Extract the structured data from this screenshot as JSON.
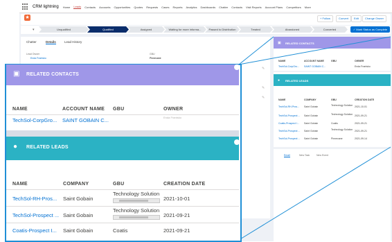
{
  "app": {
    "name": "CRM lightning"
  },
  "nav": {
    "items": [
      "Home",
      "Leads",
      "Contacts",
      "Accounts",
      "Opportunities",
      "Quotes",
      "Requests",
      "Cases",
      "Reports",
      "Analytics",
      "Dashboards",
      "Chatter",
      "Contacts",
      "Visit Reports",
      "Account Plans",
      "Competitors",
      "More"
    ],
    "active_index": 1
  },
  "header": {
    "buttons": [
      "+ Follow",
      "Convert",
      "Edit",
      "Change Owner"
    ]
  },
  "path": {
    "stages": [
      "Unqualified",
      "Qualified",
      "Assigned",
      "Waiting for more informa...",
      "Passed to Distribution",
      "Treated",
      "Abandoned",
      "Converted"
    ],
    "current_index": 1,
    "mark_status_label": "✓ Mark Status as Complete"
  },
  "details": {
    "tabs": [
      "Chatter",
      "Details",
      "Lead History"
    ],
    "active_tab": 1,
    "lead_owner_label": "Lead Owner",
    "lead_owner_value": "Enda Frantsko",
    "gbu_label": "GBU",
    "gbu_value": "Pinnecane"
  },
  "related_contacts": {
    "title": "RELATED CONTACTS",
    "columns": [
      "NAME",
      "ACCOUNT NAME",
      "GBU",
      "OWNER"
    ],
    "rows": [
      {
        "name": "TechSol-CorpGro...",
        "account": "SAINT GOBAIN C...",
        "gbu": "",
        "owner": "Enda Frantsko"
      }
    ]
  },
  "related_leads": {
    "title": "RELATED LEADS",
    "columns": [
      "NAME",
      "COMPANY",
      "GBU",
      "CREATION DATE"
    ],
    "rows": [
      {
        "name": "TechSol-RH-Pros...",
        "company": "Saint Gobain",
        "gbu": "Technology Solution",
        "date": "2021-10-01"
      },
      {
        "name": "TechSol-Prospect ...",
        "company": "Saint Gobain",
        "gbu": "Technology Solution",
        "date": "2021-09-21"
      },
      {
        "name": "Coatis-Prospect I...",
        "company": "Saint Gobain",
        "gbu": "Coatis",
        "date": "2021-09-21"
      },
      {
        "name": "TechSol-Prospect ...",
        "company": "Saint Gobain",
        "gbu": "Technology Solution",
        "date": "2021-09-21"
      },
      {
        "name": "TechSol-Prospect ...",
        "company": "Saint Gobain",
        "gbu": "Pinnecane",
        "date": "2021-09-14"
      }
    ]
  },
  "activity": {
    "tabs": [
      "Email",
      "New Task",
      "New Event"
    ]
  },
  "colors": {
    "contacts_header": "#9f97e8",
    "leads_header": "#2bb2c4",
    "brand": "#0070d2",
    "current_stage": "#0b2d6b",
    "zoom_frame": "#1f8fd6"
  }
}
